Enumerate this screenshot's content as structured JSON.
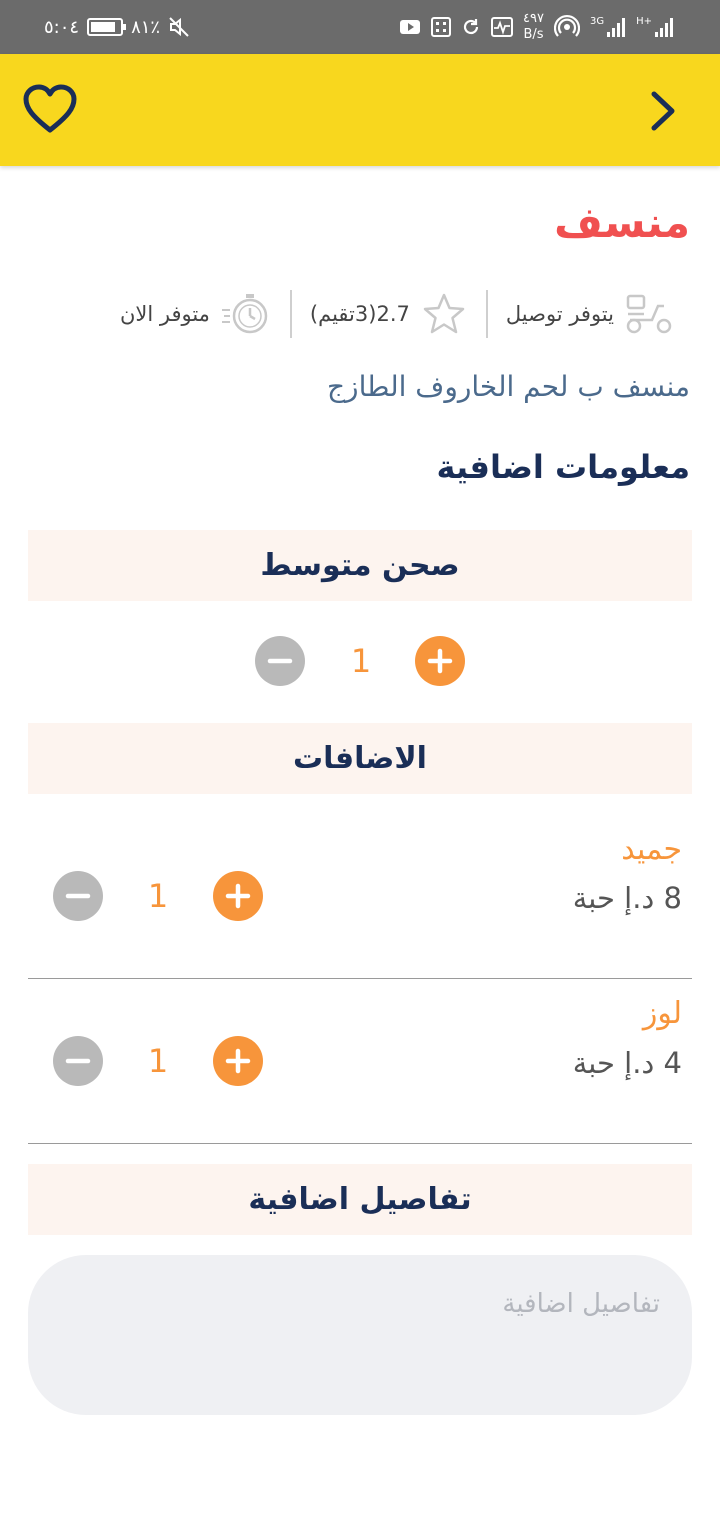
{
  "status_bar": {
    "time": "٥:٠٤",
    "battery": "٨١٪",
    "net_speed_value": "٤٩٧",
    "net_speed_unit": "B/s",
    "signal1": "3G",
    "signal2": "H+"
  },
  "header": {
    "background_color": "#f8d71e",
    "favorite_icon": "heart-icon",
    "back_icon": "chevron-right-icon"
  },
  "product": {
    "name": "منسف",
    "description": "منسف ب لحم الخاروف الطازج",
    "delivery_label": "يتوفر توصيل",
    "rating_label": "2.7(3تقيم)",
    "availability_label": "متوفر الان"
  },
  "extra_info_title": "معلومات اضافية",
  "size": {
    "title": "صحن متوسط",
    "quantity": "1"
  },
  "addons": {
    "title": "الاضافات",
    "items": [
      {
        "name": "جميد",
        "price": "8 د.إ حبة",
        "quantity": "1"
      },
      {
        "name": "لوز",
        "price": "4 د.إ حبة",
        "quantity": "1"
      }
    ]
  },
  "details": {
    "title": "تفاصيل اضافية",
    "placeholder": "تفاصيل اضافية"
  },
  "colors": {
    "accent": "#f7953b",
    "title_red": "#f05050",
    "navy": "#1a2e57",
    "band_bg": "#fdf4ef"
  }
}
